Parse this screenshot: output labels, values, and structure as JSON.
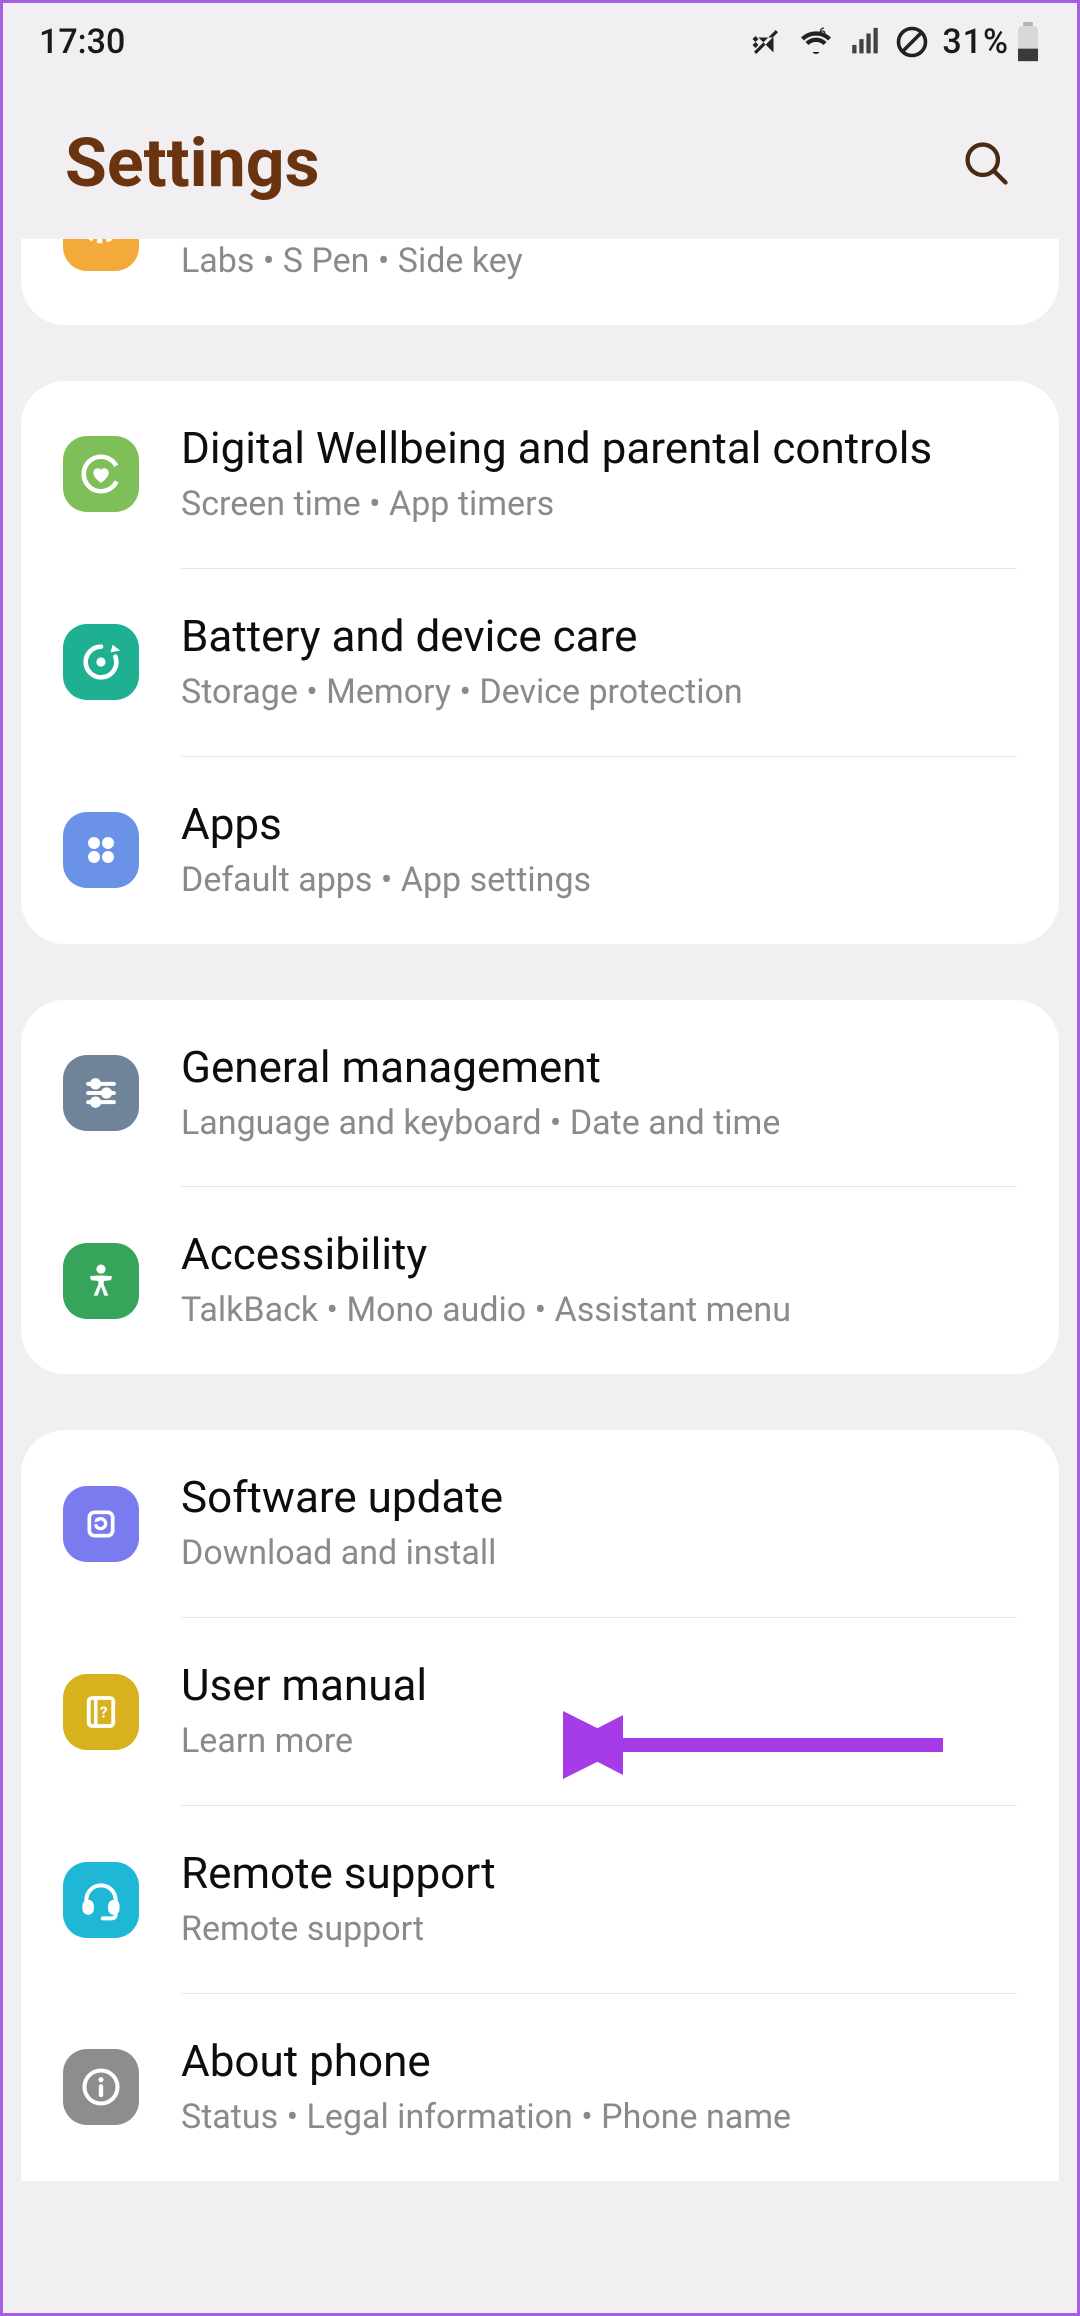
{
  "status": {
    "time": "17:30",
    "battery_pct": "31%"
  },
  "header": {
    "title": "Settings"
  },
  "groups": [
    {
      "id": "g0",
      "items": [
        {
          "id": "advanced",
          "title": "",
          "sub": "Labs  •  S Pen  •  Side key",
          "icon": "gear-icon",
          "iconClass": "ic-orange"
        }
      ]
    },
    {
      "id": "g1",
      "items": [
        {
          "id": "wellbeing",
          "title": "Digital Wellbeing and parental controls",
          "sub": "Screen time  •  App timers",
          "icon": "heart-circle-icon",
          "iconClass": "ic-green"
        },
        {
          "id": "devicecare",
          "title": "Battery and device care",
          "sub": "Storage  •  Memory  •  Device protection",
          "icon": "refresh-dot-icon",
          "iconClass": "ic-teal"
        },
        {
          "id": "apps",
          "title": "Apps",
          "sub": "Default apps  •  App settings",
          "icon": "four-dots-icon",
          "iconClass": "ic-blue"
        }
      ]
    },
    {
      "id": "g2",
      "items": [
        {
          "id": "general",
          "title": "General management",
          "sub": "Language and keyboard  •  Date and time",
          "icon": "sliders-icon",
          "iconClass": "ic-slate"
        },
        {
          "id": "accessibility",
          "title": "Accessibility",
          "sub": "TalkBack  •  Mono audio  •  Assistant menu",
          "icon": "person-icon",
          "iconClass": "ic-access"
        }
      ]
    },
    {
      "id": "g3",
      "items": [
        {
          "id": "update",
          "title": "Software update",
          "sub": "Download and install",
          "icon": "update-icon",
          "iconClass": "ic-purple"
        },
        {
          "id": "manual",
          "title": "User manual",
          "sub": "Learn more",
          "icon": "book-icon",
          "iconClass": "ic-yellow"
        },
        {
          "id": "remote",
          "title": "Remote support",
          "sub": "Remote support",
          "icon": "headset-icon",
          "iconClass": "ic-cyan"
        },
        {
          "id": "about",
          "title": "About phone",
          "sub": "Status  •  Legal information  •  Phone name",
          "icon": "info-icon",
          "iconClass": "ic-gray"
        }
      ]
    }
  ],
  "annotation": {
    "arrow_color": "#a63be8"
  }
}
